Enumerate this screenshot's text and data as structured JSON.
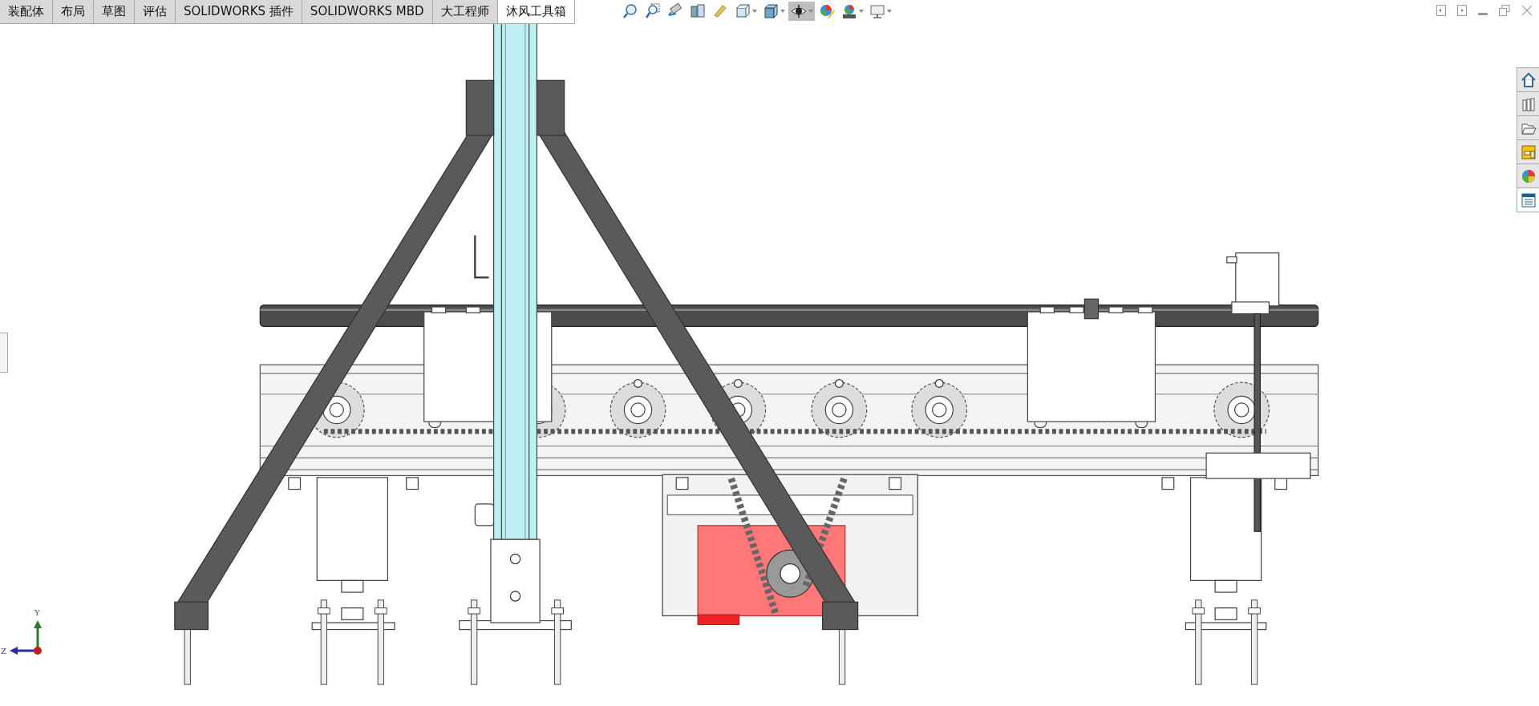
{
  "tabs": [
    {
      "label": "装配体",
      "selected": false
    },
    {
      "label": "布局",
      "selected": false
    },
    {
      "label": "草图",
      "selected": false
    },
    {
      "label": "评估",
      "selected": false
    },
    {
      "label": "SOLIDWORKS 插件",
      "selected": false
    },
    {
      "label": "SOLIDWORKS MBD",
      "selected": false
    },
    {
      "label": "大工程师",
      "selected": false
    },
    {
      "label": "沐风工具箱",
      "selected": true
    }
  ],
  "toolbar": [
    {
      "kind": "zoom-fit",
      "selected": false,
      "has_menu": false
    },
    {
      "kind": "zoom-area",
      "selected": false,
      "has_menu": false
    },
    {
      "kind": "previous-view",
      "selected": false,
      "has_menu": false
    },
    {
      "kind": "section-view",
      "selected": false,
      "has_menu": false
    },
    {
      "kind": "dynamic-annotation",
      "selected": false,
      "has_menu": false
    },
    {
      "kind": "view-orientation",
      "selected": false,
      "has_menu": true
    },
    {
      "kind": "display-style",
      "selected": false,
      "has_menu": true
    },
    {
      "kind": "hide-show",
      "selected": true,
      "has_menu": true
    },
    {
      "kind": "edit-appearance",
      "selected": false,
      "has_menu": false
    },
    {
      "kind": "scene",
      "selected": false,
      "has_menu": true
    },
    {
      "kind": "view-settings",
      "selected": false,
      "has_menu": true
    }
  ],
  "triad": {
    "y_label": "Y",
    "z_label": "Z"
  }
}
